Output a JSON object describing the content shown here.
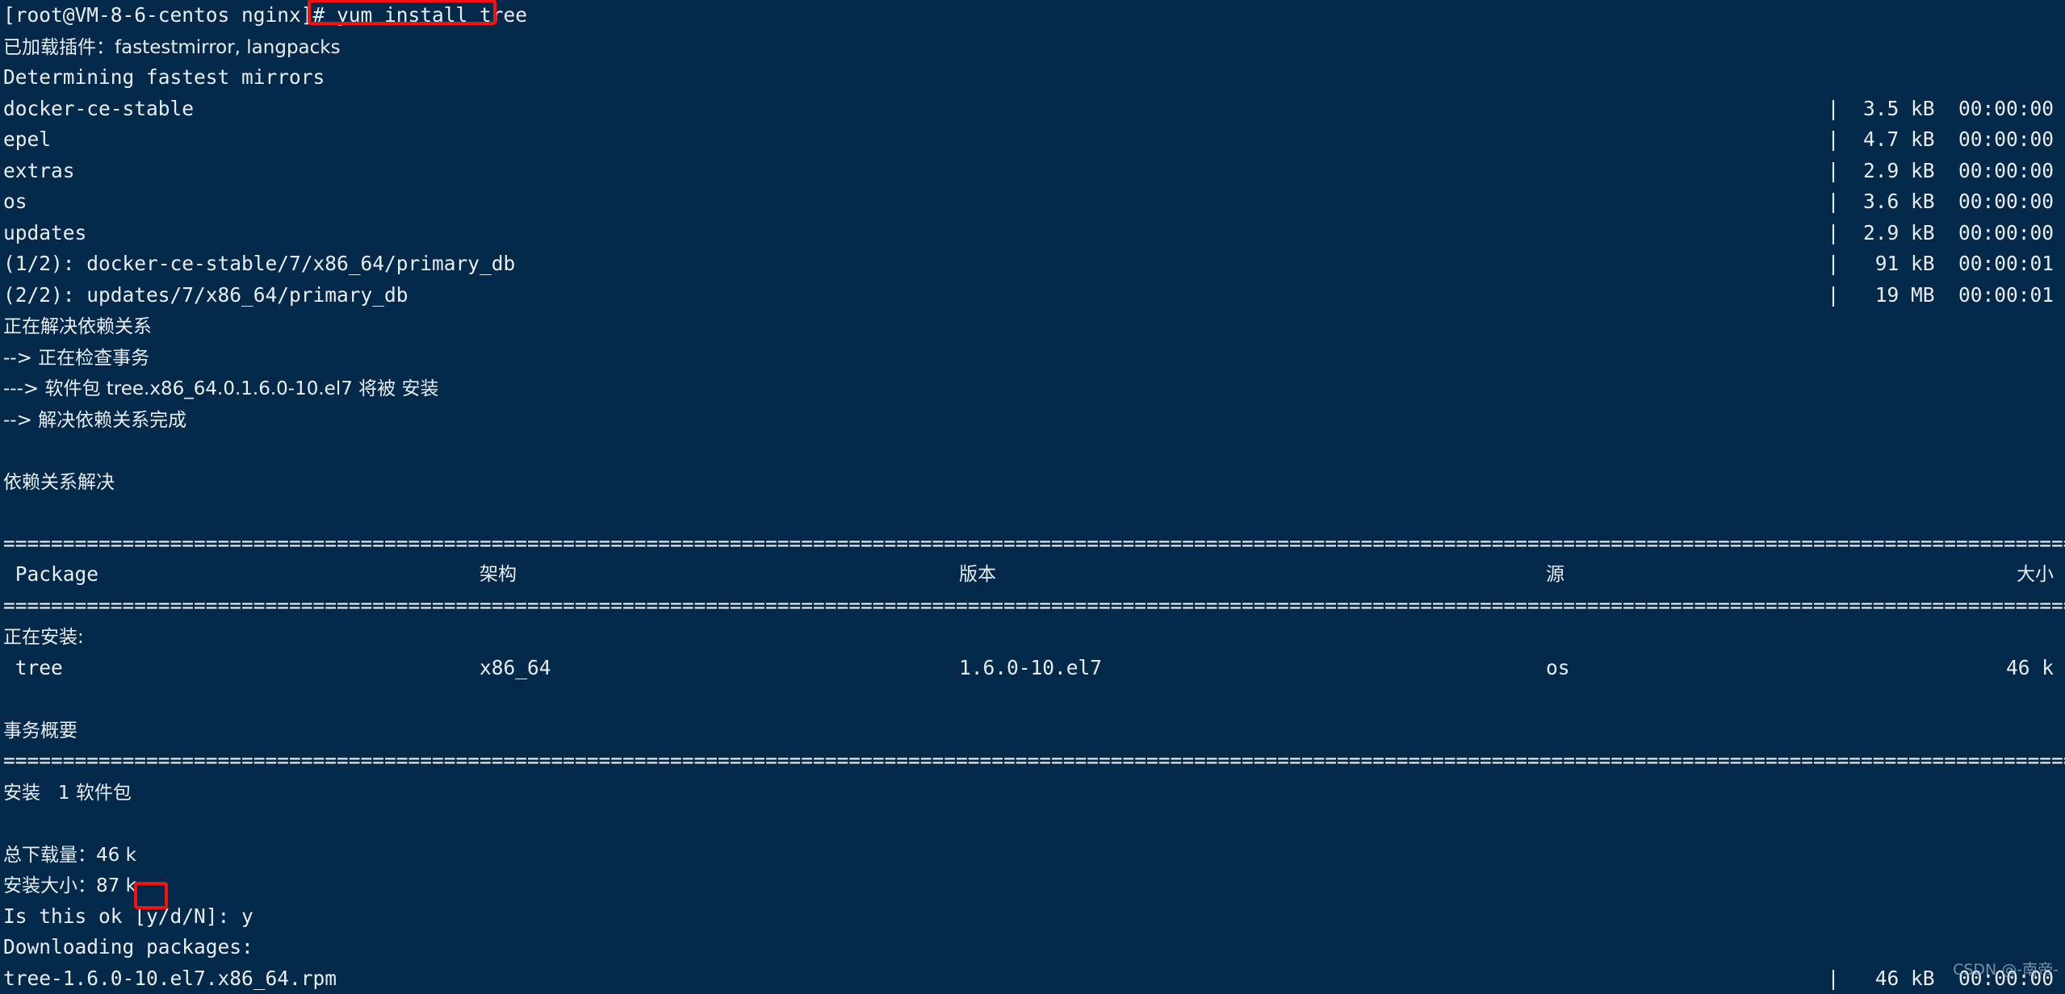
{
  "terminal": {
    "background_color": "#03294a",
    "foreground_color": "#e8eef2",
    "highlight_color": "#fa0f0f",
    "prompt": "[root@VM-8-6-centos nginx]# ",
    "command": "yum install tree"
  },
  "lines": {
    "plugins": "已加载插件：fastestmirror, langpacks",
    "determining": "Determining fastest mirrors",
    "resolving_deps": "正在解决依赖关系",
    "checking_transaction": "--> 正在检查事务",
    "package_will_install": "---> 软件包 tree.x86_64.0.1.6.0-10.el7 将被 安装",
    "deps_resolved_done": "--> 解决依赖关系完成",
    "deps_resolved_title": "依赖关系解决",
    "installing_label": "正在安装:",
    "transaction_summary_title": "事务概要",
    "install_count": "安装   1 软件包",
    "total_download": "总下载量：46 k",
    "install_size": "安装大小：87 k",
    "confirm_prompt": "Is this ok [y/d/N]: ",
    "confirm_answer": "y",
    "downloading_packages": "Downloading packages:",
    "rpm_file": "tree-1.6.0-10.el7.x86_64.rpm"
  },
  "repos": [
    {
      "name": "docker-ce-stable",
      "bar": "|",
      "size": "3.5 kB",
      "time": "00:00:00"
    },
    {
      "name": "epel",
      "bar": "|",
      "size": "4.7 kB",
      "time": "00:00:00"
    },
    {
      "name": "extras",
      "bar": "|",
      "size": "2.9 kB",
      "time": "00:00:00"
    },
    {
      "name": "os",
      "bar": "|",
      "size": "3.6 kB",
      "time": "00:00:00"
    },
    {
      "name": "updates",
      "bar": "|",
      "size": "2.9 kB",
      "time": "00:00:00"
    },
    {
      "name": "(1/2): docker-ce-stable/7/x86_64/primary_db",
      "bar": "|",
      "size": " 91 kB",
      "time": "00:00:01"
    },
    {
      "name": "(2/2): updates/7/x86_64/primary_db",
      "bar": "|",
      "size": " 19 MB",
      "time": "00:00:01"
    }
  ],
  "table": {
    "separator": "================================================================================================================================================================================================",
    "headers": {
      "package": " Package",
      "arch": "架构",
      "version": "版本",
      "repo": "源",
      "size": "大小"
    },
    "rows": [
      {
        "package": " tree",
        "arch": "x86_64",
        "version": "1.6.0-10.el7",
        "repo": "os",
        "size": "46 k"
      }
    ]
  },
  "download_row": {
    "bar": "|",
    "size": " 46 kB",
    "time": "00:00:00"
  },
  "watermark": "CSDN @-南帝-"
}
